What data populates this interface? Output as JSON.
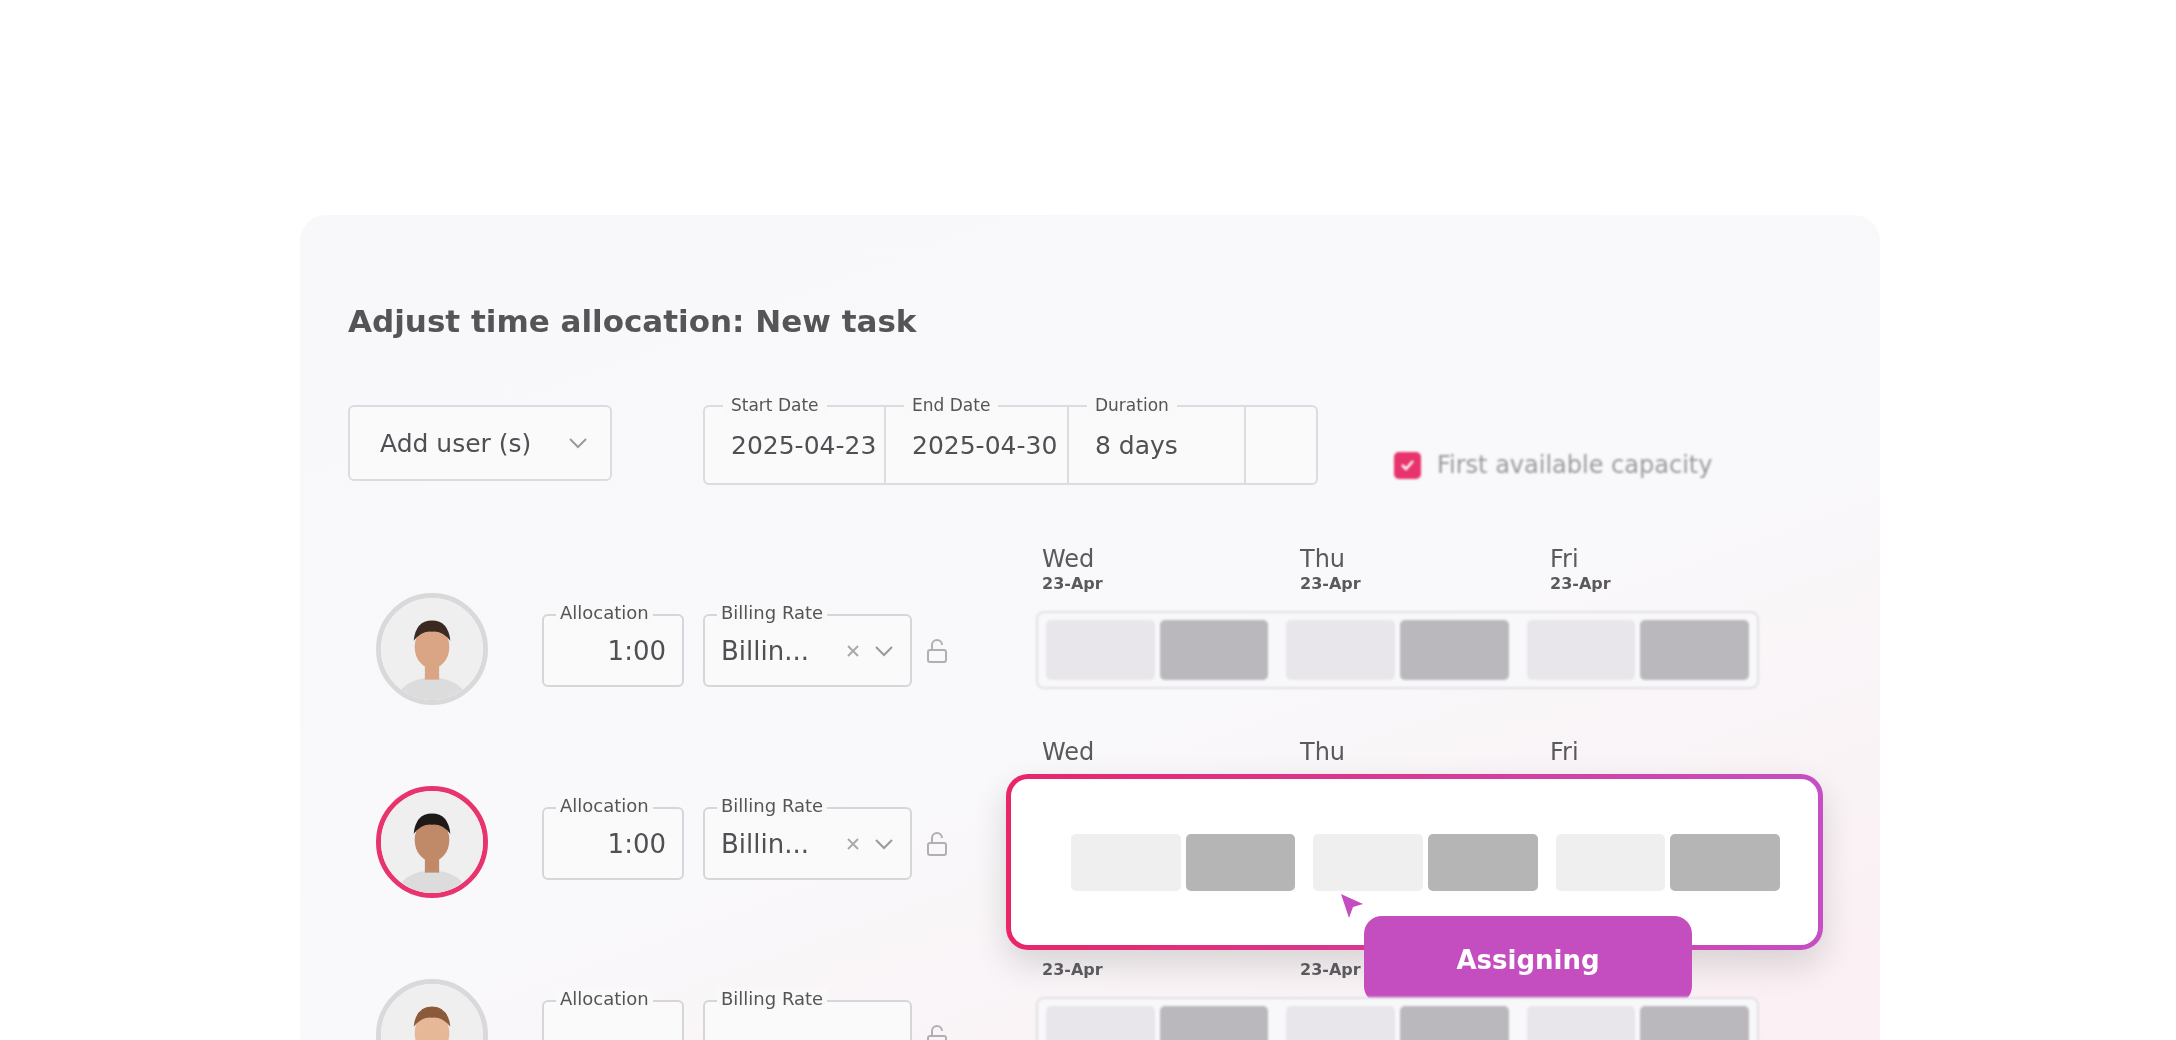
{
  "title": "Adjust time allocation: New task",
  "add_user": {
    "label": "Add user (s)"
  },
  "dates": [
    {
      "label": "Start Date",
      "value": "2025-04-23"
    },
    {
      "label": "End Date",
      "value": "2025-04-30"
    },
    {
      "label": "Duration",
      "value": "8 days"
    }
  ],
  "first_available": {
    "label": "First available capacity",
    "checked": true
  },
  "rows": [
    {
      "selected": false,
      "highlighted": false,
      "allocation": {
        "label": "Allocation",
        "value": "1:00"
      },
      "billing": {
        "label": "Billing Rate",
        "value": "Billin..."
      },
      "days": [
        {
          "day": "Wed",
          "date": "23-Apr",
          "slots": [
            {
              "filled": false
            },
            {
              "filled": true
            }
          ]
        },
        {
          "day": "Thu",
          "date": "23-Apr",
          "slots": [
            {
              "filled": false
            },
            {
              "filled": true
            }
          ]
        },
        {
          "day": "Fri",
          "date": "23-Apr",
          "slots": [
            {
              "filled": false
            },
            {
              "filled": true
            }
          ]
        }
      ]
    },
    {
      "selected": true,
      "highlighted": true,
      "action": "Assigning",
      "allocation": {
        "label": "Allocation",
        "value": "1:00"
      },
      "billing": {
        "label": "Billing Rate",
        "value": "Billin..."
      },
      "days": [
        {
          "day": "Wed",
          "slots": [
            {
              "filled": false
            },
            {
              "filled": true
            }
          ]
        },
        {
          "day": "Thu",
          "slots": [
            {
              "filled": false
            },
            {
              "filled": true
            }
          ]
        },
        {
          "day": "Fri",
          "slots": [
            {
              "filled": false
            },
            {
              "filled": true
            }
          ]
        }
      ]
    },
    {
      "selected": false,
      "highlighted": false,
      "allocation": {
        "label": "Allocation"
      },
      "billing": {
        "label": "Billing Rate"
      },
      "days": [
        {
          "date": "23-Apr",
          "slots": [
            {
              "filled": false
            },
            {
              "filled": true
            }
          ]
        },
        {
          "date": "23-Apr",
          "slots": [
            {
              "filled": false
            },
            {
              "filled": true
            }
          ]
        },
        {
          "slots": [
            {
              "filled": false
            },
            {
              "filled": true
            }
          ]
        }
      ]
    }
  ]
}
